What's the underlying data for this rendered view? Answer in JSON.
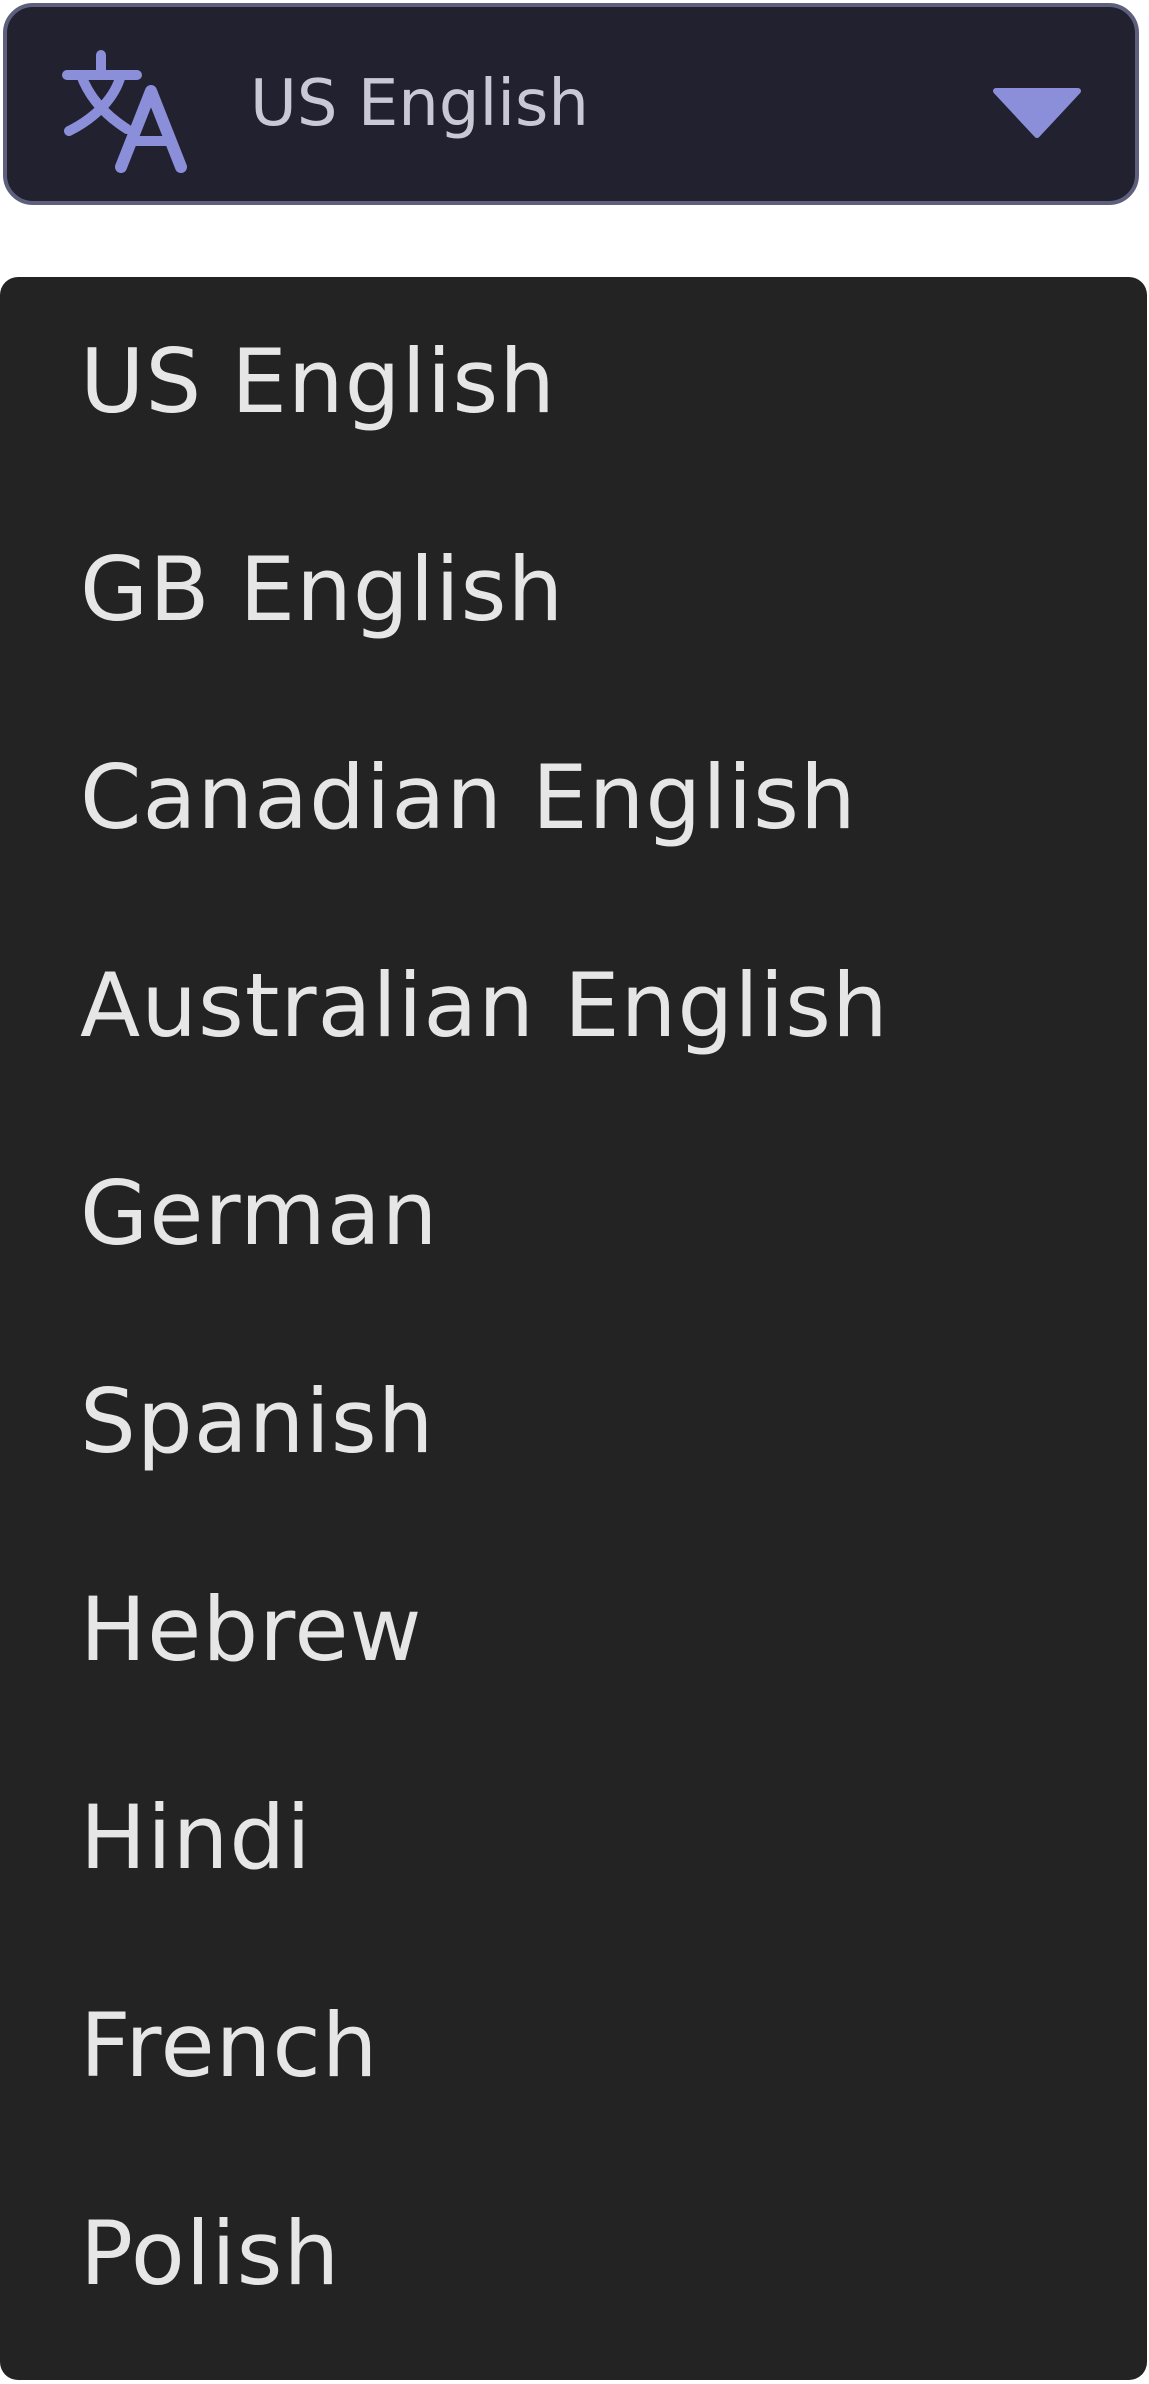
{
  "select": {
    "value": "US English",
    "icon": "translate-icon",
    "toggle_icon": "chevron-down-icon",
    "colors": {
      "background": "#21212f",
      "border": "#5e5f7c",
      "accent": "#8b8fd9",
      "text": "#c9c9d6"
    }
  },
  "menu": {
    "background": "#232323",
    "items": [
      {
        "label": "US English"
      },
      {
        "label": "GB English"
      },
      {
        "label": "Canadian English"
      },
      {
        "label": "Australian English"
      },
      {
        "label": "German"
      },
      {
        "label": "Spanish"
      },
      {
        "label": "Hebrew"
      },
      {
        "label": "Hindi"
      },
      {
        "label": "French"
      },
      {
        "label": "Polish"
      }
    ]
  }
}
